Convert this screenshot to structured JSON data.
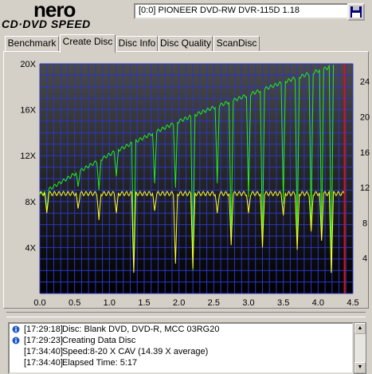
{
  "app": {
    "logo_top": "nero",
    "logo_bottom": "CD·DVD SPEED",
    "drive": "[0:0]  PIONEER DVD-RW  DVR-115D 1.18"
  },
  "tabs": [
    {
      "label": "Benchmark",
      "active": false
    },
    {
      "label": "Create Disc",
      "active": true
    },
    {
      "label": "Disc Info",
      "active": false
    },
    {
      "label": "Disc Quality",
      "active": false
    },
    {
      "label": "ScanDisc",
      "active": false
    }
  ],
  "log": [
    {
      "icon": "info-icon",
      "time": "[17:29:18]",
      "text": "Disc: Blank DVD, DVD-R, MCC 03RG20"
    },
    {
      "icon": "info-icon",
      "time": "[17:29:23]",
      "text": "Creating Data Disc"
    },
    {
      "icon": "",
      "time": "[17:34:40]",
      "text": "Speed:8-20 X CAV (14.39 X average)"
    },
    {
      "icon": "",
      "time": "[17:34:40]",
      "text": "Elapsed Time:  5:17"
    }
  ],
  "chart_data": {
    "type": "line",
    "xlim": [
      0,
      4.5
    ],
    "ylim": [
      0,
      20
    ],
    "y2lim": [
      0,
      26
    ],
    "x_ticks": [
      "0.0",
      "0.5",
      "1.0",
      "1.5",
      "2.0",
      "2.5",
      "3.0",
      "3.5",
      "4.0",
      "4.5"
    ],
    "y_ticks": [
      "4X",
      "8X",
      "12X",
      "16X",
      "20X"
    ],
    "y_tick_values": [
      4,
      8,
      12,
      16,
      20
    ],
    "y2_ticks": [
      "4",
      "8",
      "12",
      "16",
      "20",
      "24"
    ],
    "grid": true,
    "end_marker_x": 4.38,
    "series": [
      {
        "color": "#22ee22",
        "x": [
          0.0,
          0.5,
          1.0,
          1.5,
          2.0,
          2.5,
          3.0,
          3.5,
          4.0,
          4.22
        ],
        "values": [
          8.6,
          10.4,
          12.1,
          13.6,
          15.0,
          16.2,
          17.3,
          18.4,
          19.4,
          19.8
        ]
      },
      {
        "color": "#ffff33",
        "x": [
          0.0,
          4.38
        ],
        "values": [
          8.7,
          8.7
        ]
      }
    ],
    "dips": [
      {
        "x": 0.1,
        "green": 7.2,
        "yellow": 7.0
      },
      {
        "x": 0.55,
        "green": 9.3,
        "yellow": 7.4
      },
      {
        "x": 0.85,
        "green": 9.0,
        "yellow": 6.4
      },
      {
        "x": 1.1,
        "green": 10.2,
        "yellow": 7.0
      },
      {
        "x": 1.35,
        "green": 2.2,
        "yellow": 1.8
      },
      {
        "x": 1.65,
        "green": 9.6,
        "yellow": 7.2
      },
      {
        "x": 1.95,
        "green": 9.2,
        "yellow": 2.6
      },
      {
        "x": 2.2,
        "green": 2.0,
        "yellow": 2.2
      },
      {
        "x": 2.55,
        "green": 9.6,
        "yellow": 7.0
      },
      {
        "x": 2.75,
        "green": 4.6,
        "yellow": 4.2
      },
      {
        "x": 3.0,
        "green": 8.4,
        "yellow": 7.0
      },
      {
        "x": 3.2,
        "green": 4.2,
        "yellow": 4.0
      },
      {
        "x": 3.5,
        "green": 7.8,
        "yellow": 6.8
      },
      {
        "x": 3.7,
        "green": 4.4,
        "yellow": 3.8
      },
      {
        "x": 3.9,
        "green": 6.2,
        "yellow": 5.4
      },
      {
        "x": 4.05,
        "green": 5.2,
        "yellow": 4.6
      },
      {
        "x": 4.19,
        "green": 1.8,
        "yellow": 1.8
      }
    ]
  }
}
